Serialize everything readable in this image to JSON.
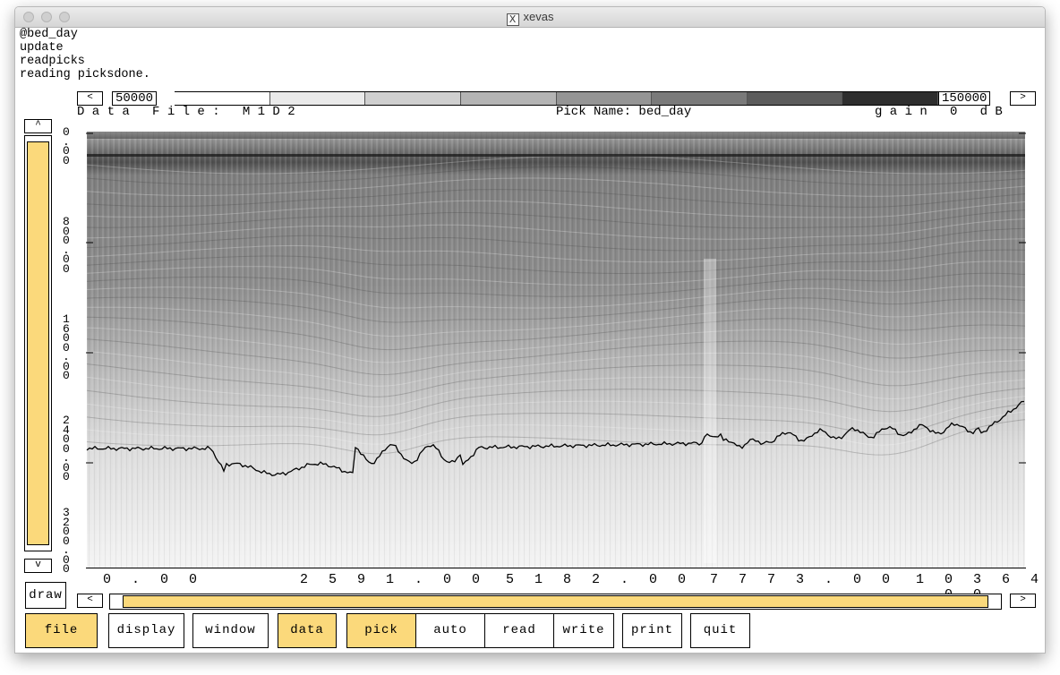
{
  "window": {
    "title": "xevas"
  },
  "console": {
    "lines": [
      "@bed_day",
      "update",
      "readpicks",
      "reading picksdone."
    ]
  },
  "scale": {
    "left_arrow": "<",
    "right_arrow": ">",
    "min_value": "50000",
    "max_value": "150000"
  },
  "info": {
    "data_file": "D a t a   F i l e :   M 1 D 2",
    "pick_name": "Pick Name: bed_day",
    "gain": "g a i n   0   d B"
  },
  "plot": {
    "y_ticks": [
      "0",
      ".",
      "0",
      "0",
      "8",
      "0",
      "0",
      ".",
      "0",
      "0",
      "1",
      "6",
      "0",
      "0",
      ".",
      "0",
      "0",
      "2",
      "4",
      "0",
      "0",
      ".",
      "0",
      "0",
      "3",
      "2",
      "0",
      "0",
      ".",
      "0",
      "0"
    ],
    "x_ticks": [
      "0 . 0 0",
      "2 5 9 1 . 0 0",
      "5 1 8 2 . 0 0",
      "7 7 7 3 . 0 0",
      "1 0 3 6 4 . 0 0"
    ],
    "colors": {
      "thumb": "#fbd97b",
      "trace": "#000000"
    }
  },
  "vscroll": {
    "up": "^",
    "down": "v"
  },
  "hscroll": {
    "left": "<",
    "right": ">"
  },
  "draw_label": "draw",
  "buttons": [
    {
      "label": "file",
      "active": true
    },
    {
      "label": "display",
      "active": false
    },
    {
      "label": "window",
      "active": false
    },
    {
      "label": "data",
      "active": true
    },
    {
      "label": "pick",
      "active": true
    },
    {
      "label": "auto",
      "active": false
    },
    {
      "label": "read",
      "active": false
    },
    {
      "label": "write",
      "active": false
    },
    {
      "label": "print",
      "active": false
    },
    {
      "label": "quit",
      "active": false
    }
  ]
}
